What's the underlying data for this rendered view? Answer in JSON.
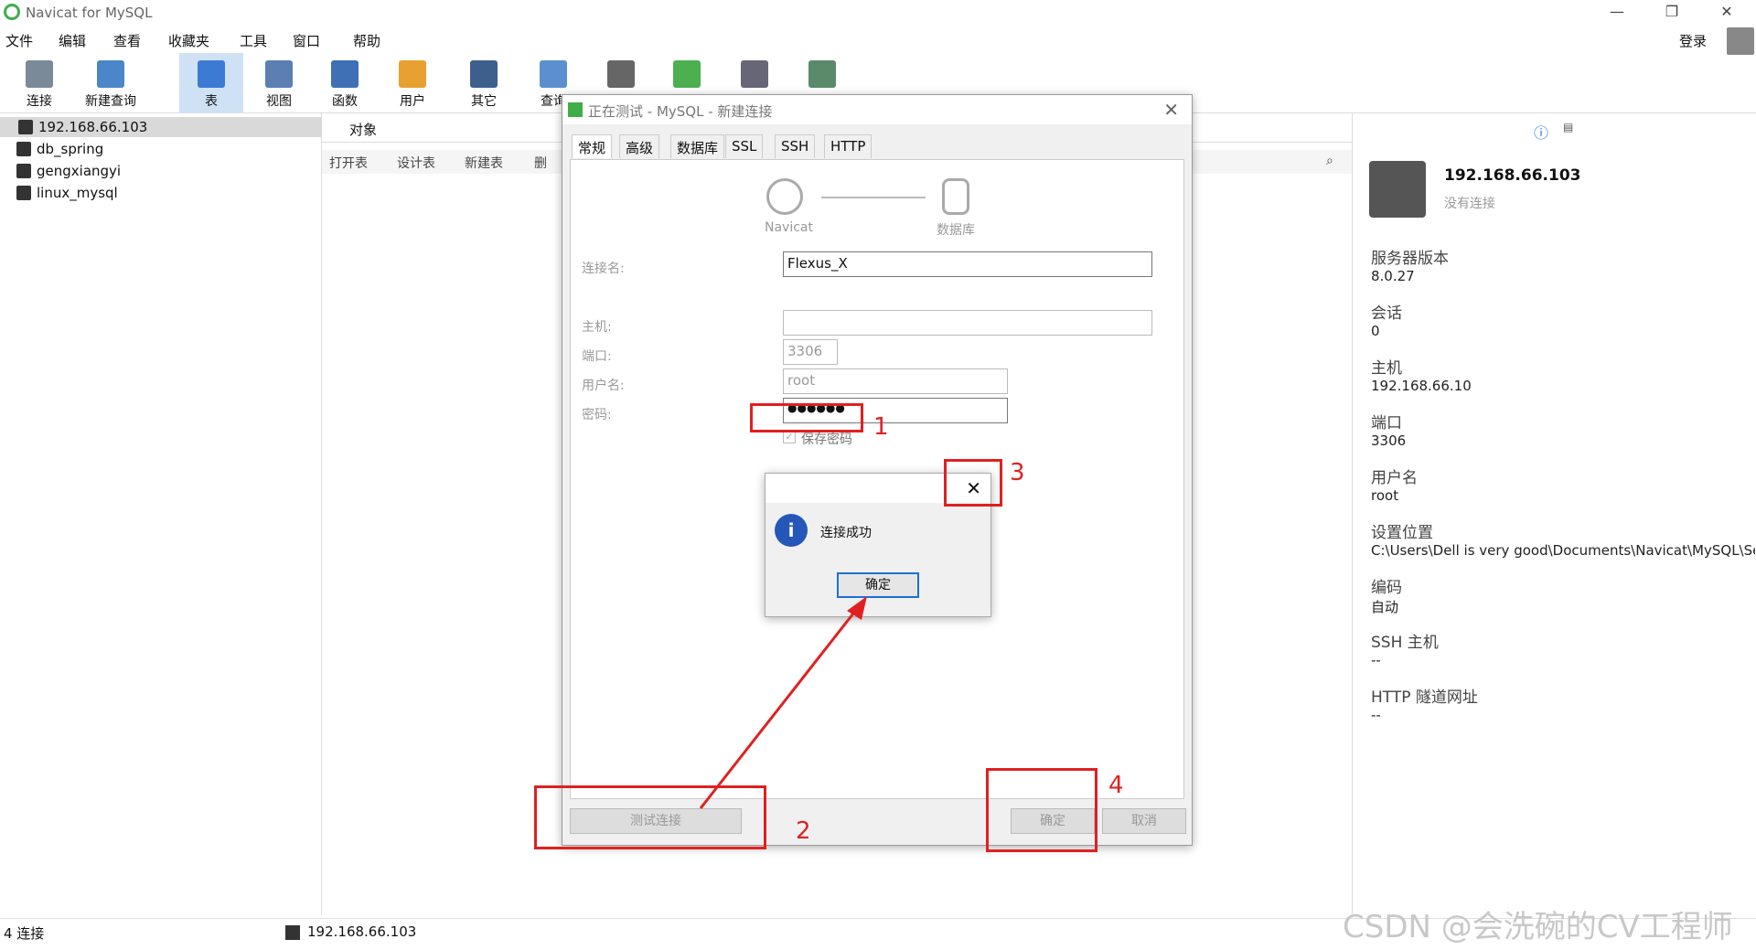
{
  "window": {
    "title": "Navicat for MySQL",
    "min": "—",
    "max": "❐",
    "close": "✕"
  },
  "menu": [
    "文件",
    "编辑",
    "查看",
    "收藏夹",
    "工具",
    "窗口",
    "帮助"
  ],
  "login": "登录",
  "toolbar": [
    "连接",
    "新建查询",
    "表",
    "视图",
    "函数",
    "用户",
    "其它",
    "查询"
  ],
  "connections": [
    "192.168.66.103",
    "db_spring",
    "gengxiangyi",
    "linux_mysql"
  ],
  "objtab": "对象",
  "objbar": [
    "打开表",
    "设计表",
    "新建表",
    "删"
  ],
  "right": {
    "name": "192.168.66.103",
    "status": "没有连接",
    "fields": [
      {
        "k": "服务器版本",
        "v": "8.0.27"
      },
      {
        "k": "会话",
        "v": "0"
      },
      {
        "k": "主机",
        "v": "192.168.66.10"
      },
      {
        "k": "端口",
        "v": "3306"
      },
      {
        "k": "用户名",
        "v": "root"
      },
      {
        "k": "设置位置",
        "v": "C:\\Users\\Dell is very good\\Documents\\Navicat\\MySQL\\Se"
      },
      {
        "k": "编码",
        "v": "自动"
      },
      {
        "k": "SSH 主机",
        "v": "--"
      },
      {
        "k": "HTTP 隧道网址",
        "v": "--"
      }
    ]
  },
  "status": {
    "left": "4 连接",
    "right": "192.168.66.103"
  },
  "watermark": "CSDN @会洗碗的CV工程师",
  "dialog": {
    "title": "正在测试 - MySQL - 新建连接",
    "tabs": [
      "常规",
      "高级",
      "数据库",
      "SSL",
      "SSH",
      "HTTP"
    ],
    "navicat": "Navicat",
    "database": "数据库",
    "labels": {
      "name": "连接名:",
      "host": "主机:",
      "port": "端口:",
      "user": "用户名:",
      "pwd": "密码:"
    },
    "values": {
      "name": "Flexus_X",
      "host": "",
      "port": "3306",
      "user": "root",
      "pwd": "●●●●●●"
    },
    "save_pwd": "保存密码",
    "test_btn": "测试连接",
    "ok_btn": "确定",
    "cancel_btn": "取消"
  },
  "msgbox": {
    "text": "连接成功",
    "ok": "确定",
    "close": "✕"
  },
  "annotations": [
    "1",
    "2",
    "3",
    "4"
  ]
}
